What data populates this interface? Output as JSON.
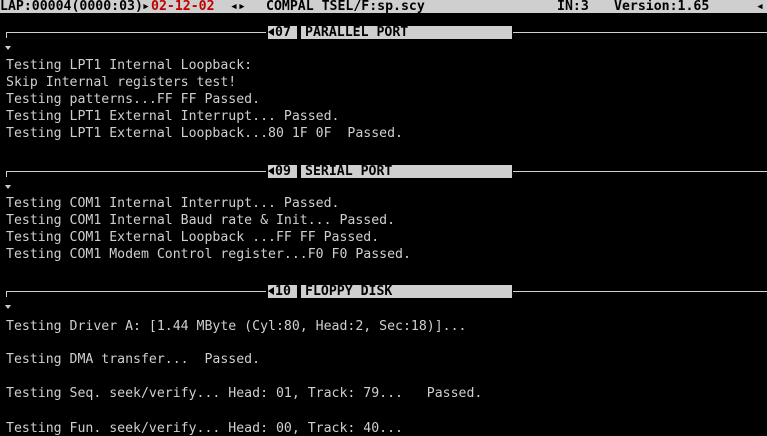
{
  "status_bar": {
    "prefix": "LAP:00004(0000:03)",
    "date": "02-12-02",
    "program": "COMPAL TSEL/F:sp.scy",
    "in": "IN:3",
    "version": "Version:1.65"
  },
  "sections": [
    {
      "number": "07",
      "title": "PARALLEL PORT",
      "lines": [
        "Testing LPT1 Internal Loopback:",
        "Skip Internal registers test!",
        "Testing patterns...FF FF Passed.",
        "Testing LPT1 External Interrupt... Passed.",
        "Testing LPT1 External Loopback...80 1F 0F  Passed."
      ]
    },
    {
      "number": "09",
      "title": "SERIAL PORT",
      "lines": [
        "Testing COM1 Internal Interrupt... Passed.",
        "Testing COM1 Internal Baud rate & Init... Passed.",
        "Testing COM1 External Loopback ...FF FF Passed.",
        "Testing COM1 Modem Control register...F0 F0 Passed."
      ]
    },
    {
      "number": "10",
      "title": "FLOPPY DISK",
      "lines": [
        "Testing Driver A: [1.44 MByte (Cyl:80, Head:2, Sec:18)]...",
        "Testing DMA transfer...  Passed.",
        "Testing Seq. seek/verify... Head: 01, Track: 79...   Passed.",
        "Testing Fun. seek/verify... Head: 00, Track: 40..."
      ]
    }
  ]
}
